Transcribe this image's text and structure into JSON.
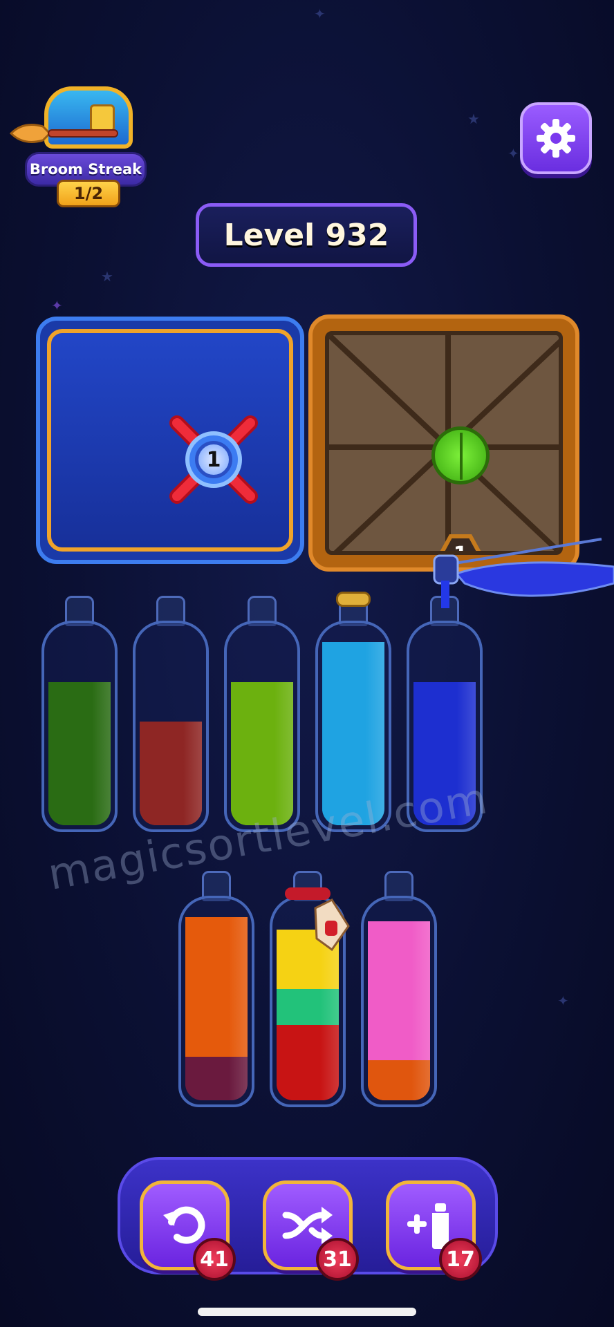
{
  "streak": {
    "title": "Broom Streak",
    "progress": "1/2"
  },
  "settings": {
    "icon": "gear-icon"
  },
  "level": {
    "label": "Level 932"
  },
  "obstacles": {
    "blue_vault": {
      "count": "1",
      "icon": "valve-icon"
    },
    "wooden_crate": {
      "count": "1",
      "icon": "green-button-icon"
    }
  },
  "bottles": [
    {
      "layers": [
        {
          "color": "#2a6c14",
          "fraction": 0.72
        }
      ]
    },
    {
      "layers": [
        {
          "color": "#8e2624",
          "fraction": 0.52
        }
      ]
    },
    {
      "layers": [
        {
          "color": "#6cb10f",
          "fraction": 0.72
        }
      ]
    },
    {
      "layers": [
        {
          "color": "#1fa3e2",
          "fraction": 0.92
        }
      ],
      "cork": true
    },
    {
      "layers": [
        {
          "color": "#1d2fd0",
          "fraction": 0.72
        }
      ],
      "pouring": true
    },
    {
      "layers": [
        {
          "color": "#6a1a3e",
          "fraction": 0.22
        },
        {
          "color": "#e55a0c",
          "fraction": 0.7
        }
      ]
    },
    {
      "layers": [
        {
          "color": "#c81414",
          "fraction": 0.38
        },
        {
          "color": "#22c27a",
          "fraction": 0.18
        },
        {
          "color": "#f5d214",
          "fraction": 0.3
        }
      ],
      "tied": true
    },
    {
      "layers": [
        {
          "color": "#e0560e",
          "fraction": 0.2
        },
        {
          "color": "#f05cc7",
          "fraction": 0.7
        }
      ]
    }
  ],
  "watermark": "magicsortlevel.com",
  "tools": [
    {
      "icon": "undo-icon",
      "count": "41"
    },
    {
      "icon": "shuffle-icon",
      "count": "31"
    },
    {
      "icon": "add-bottle-icon",
      "count": "17"
    }
  ]
}
